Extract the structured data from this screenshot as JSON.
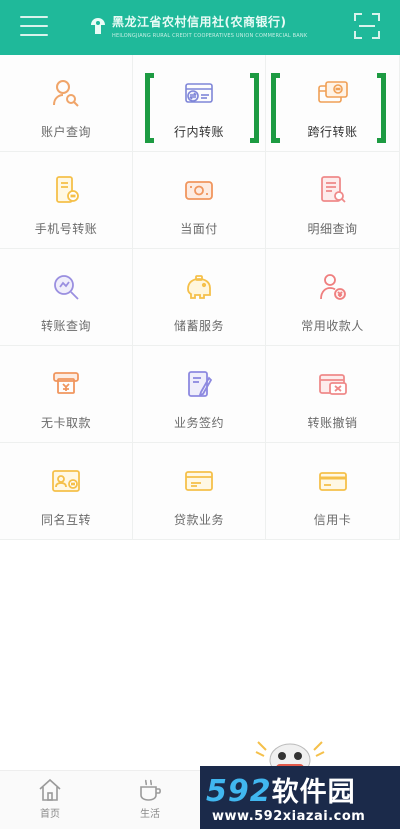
{
  "header": {
    "bank_name": "黑龙江省农村信用社(农商银行)",
    "bank_name_en": "HEILONGJIANG RURAL CREDIT COOPERATIVES UNION COMMERCIAL BANK"
  },
  "grid": {
    "items": [
      {
        "label": "账户查询",
        "icon": "account-query-icon",
        "color": "#f0a56a"
      },
      {
        "label": "行内转账",
        "icon": "intra-bank-transfer-icon",
        "color": "#7f86d8",
        "highlighted": true
      },
      {
        "label": "跨行转账",
        "icon": "inter-bank-transfer-icon",
        "color": "#f0a056",
        "highlighted": true
      },
      {
        "label": "手机号转账",
        "icon": "phone-transfer-icon",
        "color": "#f5c04a"
      },
      {
        "label": "当面付",
        "icon": "face-pay-icon",
        "color": "#f0965e"
      },
      {
        "label": "明细查询",
        "icon": "detail-query-icon",
        "color": "#ef8a8a"
      },
      {
        "label": "转账查询",
        "icon": "transfer-query-icon",
        "color": "#9a8fe0"
      },
      {
        "label": "储蓄服务",
        "icon": "savings-icon",
        "color": "#f5c04a"
      },
      {
        "label": "常用收款人",
        "icon": "payee-icon",
        "color": "#ef7f7f"
      },
      {
        "label": "无卡取款",
        "icon": "cardless-withdraw-icon",
        "color": "#f0965e"
      },
      {
        "label": "业务签约",
        "icon": "contract-icon",
        "color": "#8d89e0"
      },
      {
        "label": "转账撤销",
        "icon": "transfer-cancel-icon",
        "color": "#ef8a8a"
      },
      {
        "label": "同名互转",
        "icon": "same-name-transfer-icon",
        "color": "#f5c04a"
      },
      {
        "label": "贷款业务",
        "icon": "loan-icon",
        "color": "#f5c04a"
      },
      {
        "label": "信用卡",
        "icon": "credit-card-icon",
        "color": "#f5c04a"
      }
    ]
  },
  "nav": {
    "items": [
      {
        "label": "首页",
        "icon": "home-icon"
      },
      {
        "label": "生活",
        "icon": "life-icon"
      }
    ]
  },
  "watermark": {
    "brand_num": "592",
    "brand_cn": "软件园",
    "url": "www.592xiazai.com"
  }
}
